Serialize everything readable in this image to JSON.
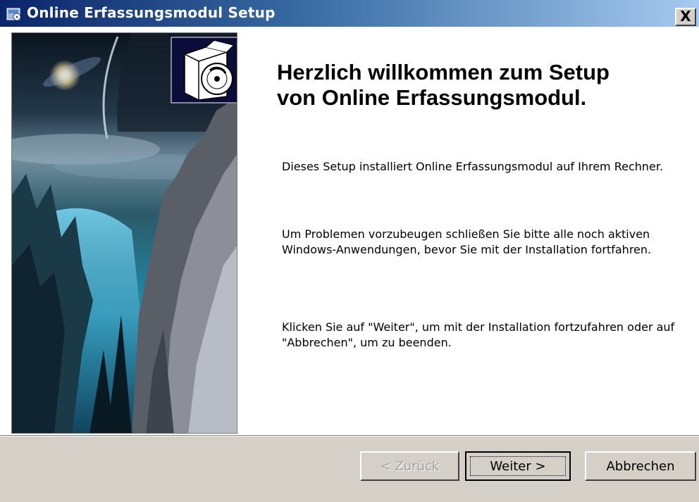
{
  "window": {
    "title": "Online Erfassungsmodul Setup",
    "close_label": "X"
  },
  "content": {
    "heading": "Herzlich willkommen zum Setup\nvon Online Erfassungsmodul.",
    "paragraph_1": "Dieses Setup installiert Online Erfassungsmodul auf Ihrem Rechner.",
    "paragraph_2": "Um Problemen vorzubeugen schließen Sie bitte alle noch aktiven Windows-Anwendungen, bevor Sie mit der Installation fortfahren.",
    "paragraph_3": "Klicken Sie auf \"Weiter\", um mit der Installation fortzufahren oder auf \"Abbrechen\", um zu beenden."
  },
  "buttons": {
    "back": "< Zurück",
    "next": "Weiter >",
    "cancel": "Abbrechen"
  },
  "icons": {
    "title_icon": "installer-icon",
    "setup_icon": "box-cd-icon",
    "side_image": "fantasy-landscape-image"
  },
  "colors": {
    "titlebar_start": "#0a246a",
    "titlebar_end": "#a6caf0",
    "dialog_bg": "#d4d0c8"
  }
}
